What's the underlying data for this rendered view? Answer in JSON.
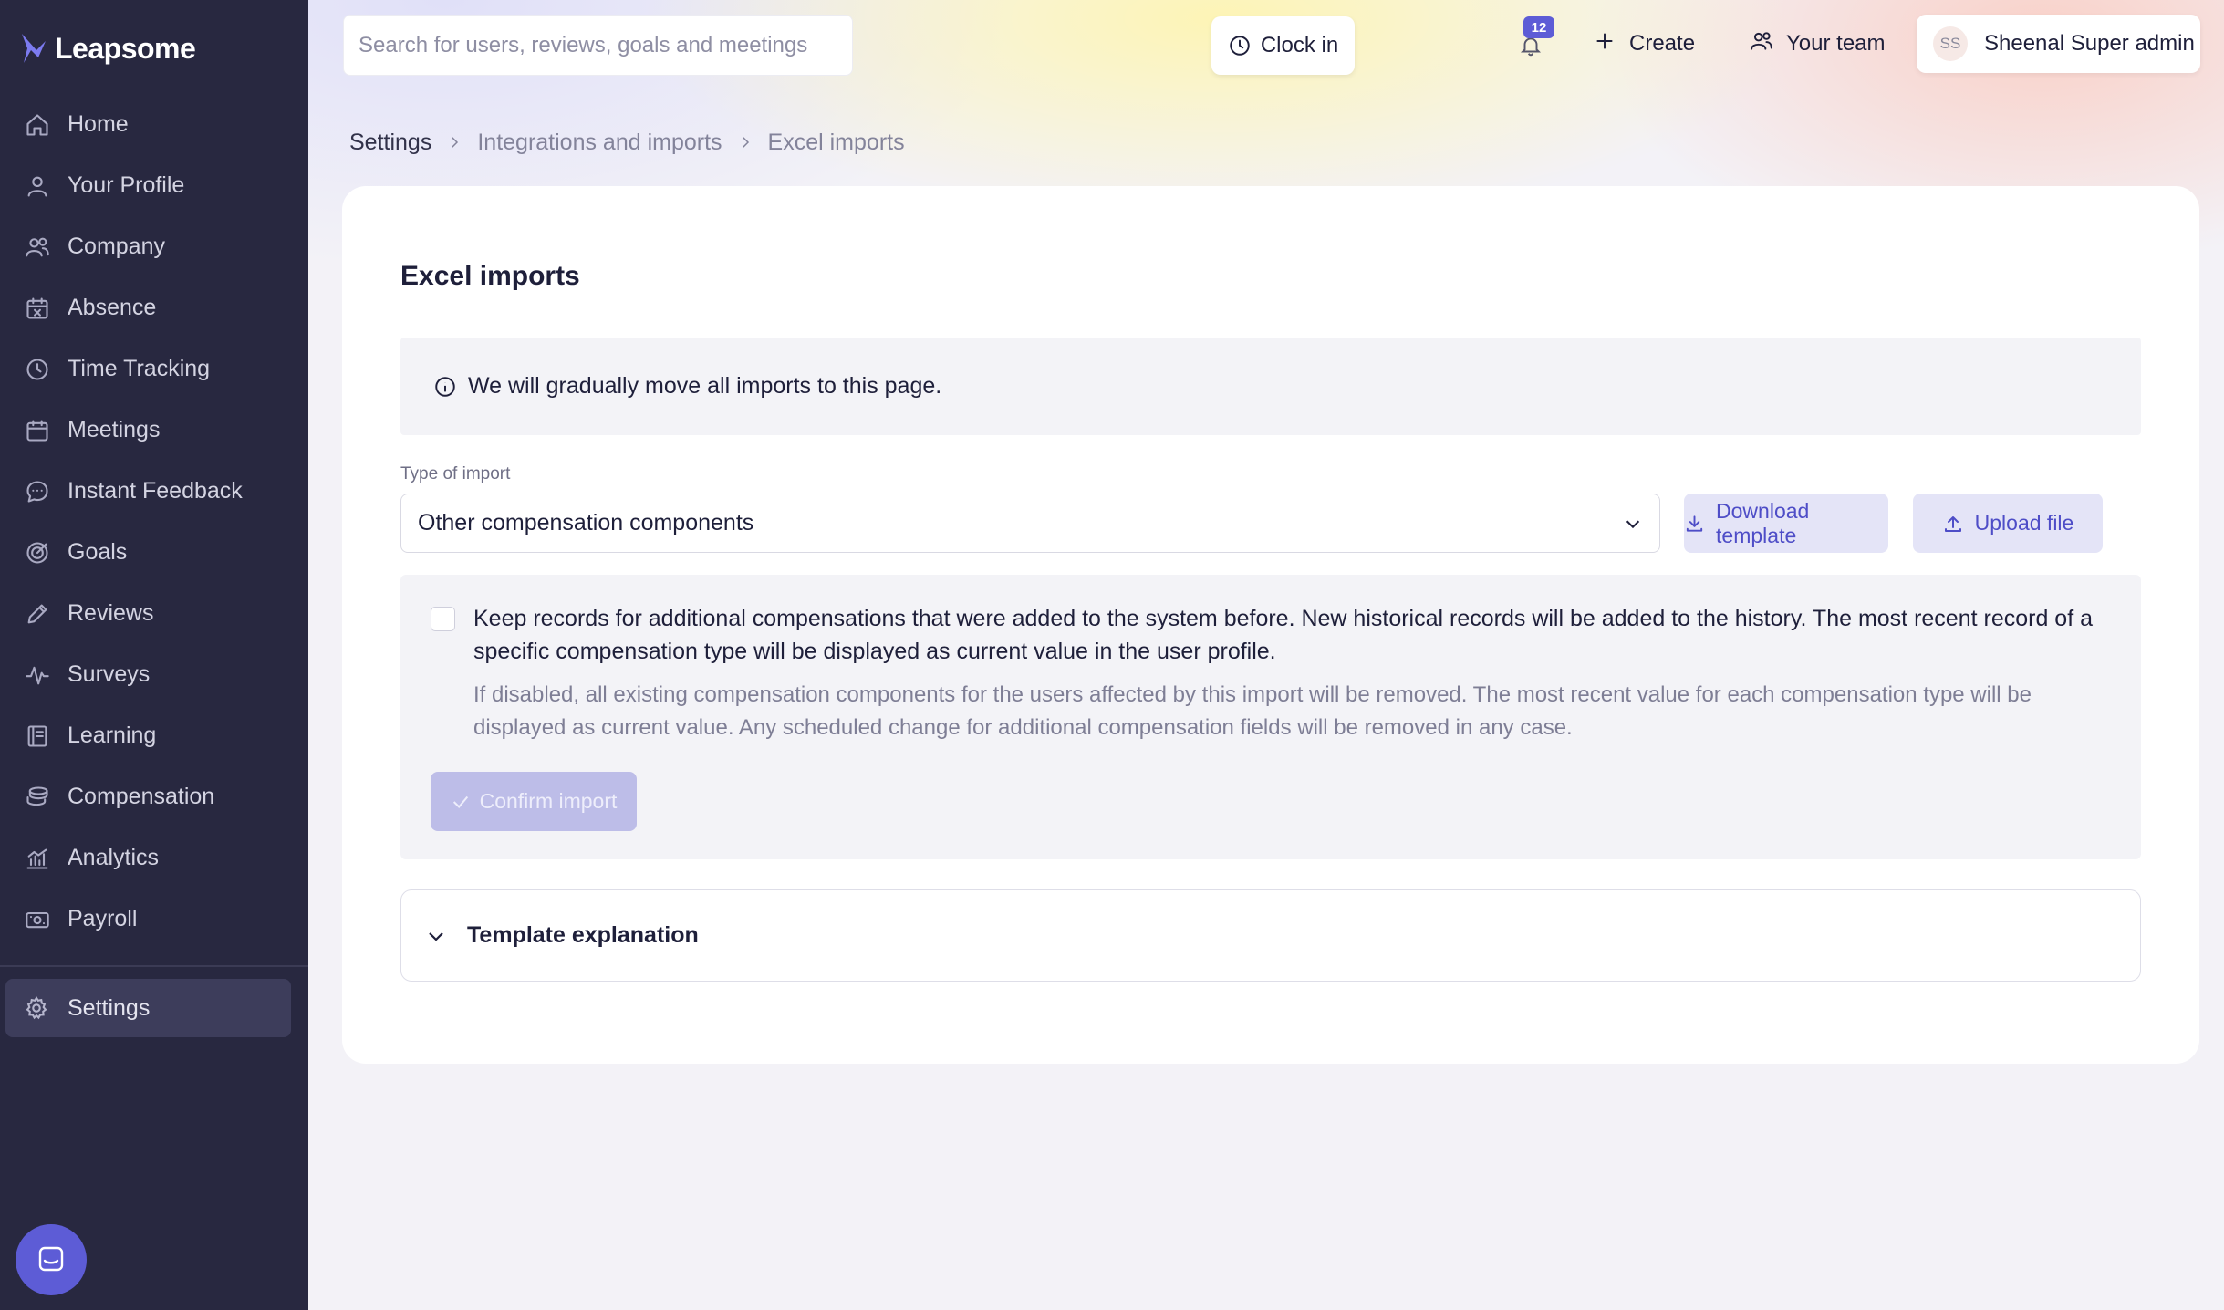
{
  "app": {
    "brand": "Leapsome",
    "colors": {
      "sidebar_bg": "#282840",
      "accent": "#5d5cd6",
      "accent_soft": "#e4e4f7"
    }
  },
  "sidebar": {
    "items": [
      {
        "label": "Home",
        "icon": "home-icon"
      },
      {
        "label": "Your Profile",
        "icon": "user-icon"
      },
      {
        "label": "Company",
        "icon": "users-icon"
      },
      {
        "label": "Absence",
        "icon": "calendar-x-icon"
      },
      {
        "label": "Time Tracking",
        "icon": "clock-icon"
      },
      {
        "label": "Meetings",
        "icon": "calendar-icon"
      },
      {
        "label": "Instant Feedback",
        "icon": "chat-icon"
      },
      {
        "label": "Goals",
        "icon": "target-icon"
      },
      {
        "label": "Reviews",
        "icon": "pencil-icon"
      },
      {
        "label": "Surveys",
        "icon": "pulse-icon"
      },
      {
        "label": "Learning",
        "icon": "book-icon"
      },
      {
        "label": "Compensation",
        "icon": "coins-icon"
      },
      {
        "label": "Analytics",
        "icon": "chart-icon"
      },
      {
        "label": "Payroll",
        "icon": "money-icon"
      }
    ],
    "settings_label": "Settings"
  },
  "topbar": {
    "search_placeholder": "Search for users, reviews, goals and meetings",
    "clock_in_label": "Clock in",
    "notifications_count": "12",
    "create_label": "Create",
    "your_team_label": "Your team",
    "user_initials": "SS",
    "user_name": "Sheenal Super admin"
  },
  "breadcrumb": {
    "root": "Settings",
    "middle": "Integrations and imports",
    "current": "Excel imports"
  },
  "main": {
    "title": "Excel imports",
    "info_text": "We will gradually move all imports to this page.",
    "type_label": "Type of import",
    "type_value": "Other compensation components",
    "download_label": "Download template",
    "upload_label": "Upload file",
    "keep_records_text": "Keep records for additional compensations that were added to the system before. New historical records will be added to the history. The most recent record of a specific compensation type will be displayed as current value in the user profile.",
    "keep_records_help": "If disabled, all existing compensation components for the users affected by this import will be removed. The most recent value for each compensation type will be displayed as current value. Any scheduled change for additional compensation fields will be removed in any case.",
    "confirm_label": "Confirm import",
    "template_explanation_label": "Template explanation"
  }
}
